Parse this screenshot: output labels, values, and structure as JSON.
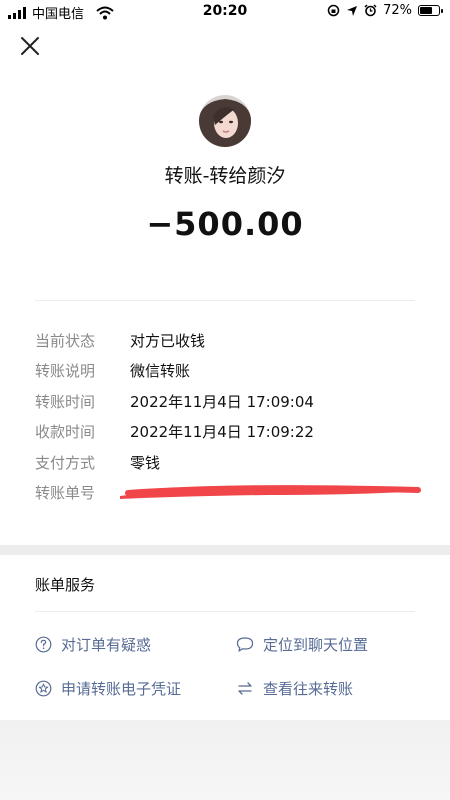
{
  "status_bar": {
    "carrier": "中国电信",
    "time": "20:20",
    "battery": "72%",
    "battery_level": 0.72
  },
  "header": {
    "title": "转账-转给颜汐",
    "amount": "−500.00"
  },
  "details": [
    {
      "label": "当前状态",
      "value": "对方已收钱"
    },
    {
      "label": "转账说明",
      "value": "微信转账"
    },
    {
      "label": "转账时间",
      "value": "2022年11月4日 17:09:04"
    },
    {
      "label": "收款时间",
      "value": "2022年11月4日 17:09:22"
    },
    {
      "label": "支付方式",
      "value": "零钱"
    },
    {
      "label": "转账单号",
      "value": ""
    }
  ],
  "services": {
    "title": "账单服务",
    "items": [
      {
        "label": "对订单有疑惑",
        "icon": "question-circle-icon"
      },
      {
        "label": "定位到聊天位置",
        "icon": "chat-bubble-icon"
      },
      {
        "label": "申请转账电子凭证",
        "icon": "star-circle-icon"
      },
      {
        "label": "查看往来转账",
        "icon": "swap-arrows-icon"
      }
    ]
  },
  "colors": {
    "link": "#576b95",
    "label_gray": "#8a8a8a",
    "redaction": "#f0464a"
  }
}
